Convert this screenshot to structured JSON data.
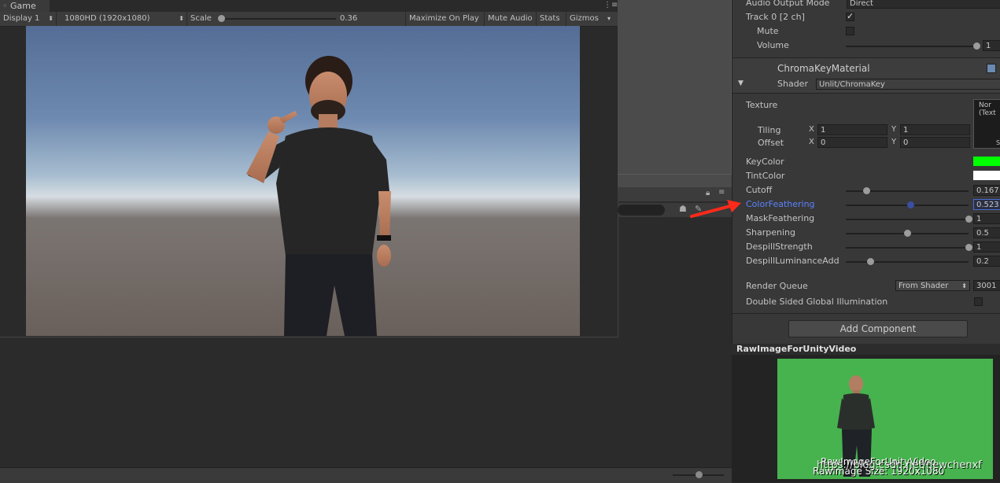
{
  "game": {
    "tab_label": "Game",
    "display": "Display 1",
    "resolution": "1080HD (1920x1080)",
    "scale_label": "Scale",
    "scale_value": "0.36",
    "buttons": [
      "Maximize On Play",
      "Mute Audio",
      "Stats",
      "Gizmos"
    ]
  },
  "inspector": {
    "audio_output_mode_label": "Audio Output Mode",
    "audio_output_mode_value": "Direct",
    "track_label": "Track 0 [2 ch]",
    "mute_label": "Mute",
    "volume_label": "Volume",
    "volume_value": "1",
    "material_name": "ChromaKeyMaterial",
    "shader_label": "Shader",
    "shader_value": "Unlit/ChromaKey",
    "texture_label": "Texture",
    "texture_preview_text": "Nor",
    "texture_preview_text2": "(Text",
    "texture_preview_btn": "S",
    "tiling_label": "Tiling",
    "offset_label": "Offset",
    "tiling_x": "1",
    "tiling_y": "1",
    "offset_x": "0",
    "offset_y": "0",
    "axis_x": "X",
    "axis_y": "Y",
    "keycolor_label": "KeyColor",
    "tintcolor_label": "TintColor",
    "keycolor": "#00ff00",
    "tintcolor": "#ffffff",
    "sliders": [
      {
        "label": "Cutoff",
        "value": "0.167",
        "fraction": 0.167
      },
      {
        "label": "ColorFeathering",
        "value": "0.523",
        "fraction": 0.523
      },
      {
        "label": "MaskFeathering",
        "value": "1",
        "fraction": 1
      },
      {
        "label": "Sharpening",
        "value": "0.5",
        "fraction": 0.5
      },
      {
        "label": "DespillStrength",
        "value": "1",
        "fraction": 1
      },
      {
        "label": "DespillLuminanceAdd",
        "value": "0.2",
        "fraction": 0.2
      }
    ],
    "render_queue_label": "Render Queue",
    "render_queue_mode": "From Shader",
    "render_queue_value": "3001",
    "dsgi_label": "Double Sided Global Illumination",
    "add_component_label": "Add Component"
  },
  "preview": {
    "title": "RawImageForUnityVideo",
    "caption1": "RawImageForUnityVideo",
    "caption2": "RawImage Size: 1920x1080",
    "watermark": "https://blog.csdn.net/newchenxf"
  },
  "colors": {
    "highlight_label": "#5b82ff",
    "arrow": "#ff2a1a",
    "green_screen": "#47b34f"
  }
}
